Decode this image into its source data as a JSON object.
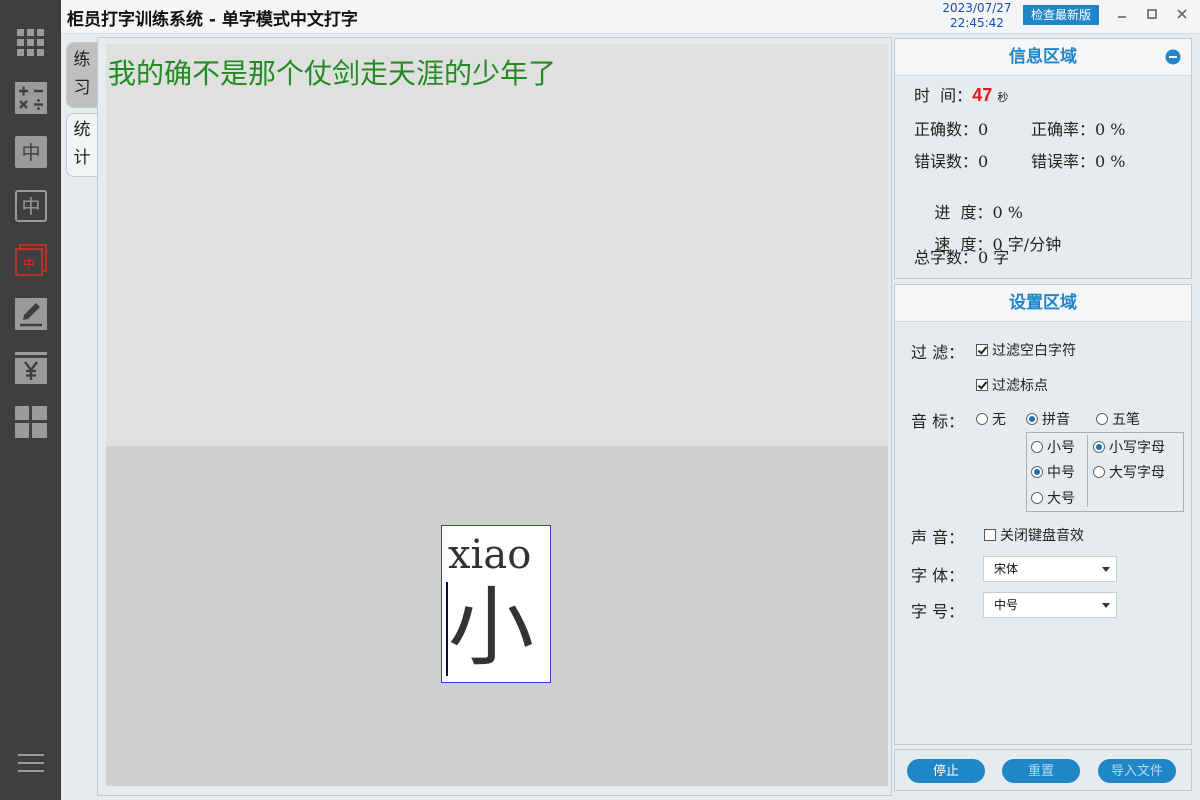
{
  "window": {
    "title": "柜员打字训练系统 - 单字模式中文打字",
    "date": "2023/07/27",
    "time": "22:45:42",
    "update_label": "检查最新版"
  },
  "rail": {
    "icons": [
      "grid-icon",
      "calculator-icon",
      "chinese-char-filled-icon",
      "chinese-char-outline-icon",
      "chinese-char-layered-icon",
      "pen-icon",
      "yen-icon",
      "tiles-icon",
      "menu-icon"
    ],
    "active_color": "#d93025",
    "icon_color": "#9a9a9a",
    "labels": {
      "zhong": "中"
    }
  },
  "tabs": {
    "practice": [
      "练",
      "习"
    ],
    "stats": [
      "统",
      "计"
    ]
  },
  "practice": {
    "text": "我的确不是那个仗剑走天涯的少年了",
    "pinyin": "xiao",
    "char": "小",
    "text_color": "#228b22"
  },
  "info": {
    "title": "信息区域",
    "time_label": "时  间：",
    "time_value": "47",
    "time_unit": "秒",
    "correct_label": "正确数：",
    "correct_value": "0",
    "accuracy_label": "正确率：",
    "accuracy_value": "0 %",
    "error_label": "错误数：",
    "error_value": "0",
    "error_rate_label": "错误率：",
    "error_rate_value": "0 %",
    "progress_label": "进  度：",
    "progress_value": "0 %",
    "speed_label": "速  度：",
    "speed_value": "0 字/分钟",
    "total_label": "总字数：",
    "total_value": "0 字"
  },
  "settings": {
    "title": "设置区域",
    "filter_label": "过 滤：",
    "filter_whitespace": "过滤空白字符",
    "filter_punct": "过滤标点",
    "phonetic_label": "音 标：",
    "phonetic_none": "无",
    "phonetic_pinyin": "拼音",
    "phonetic_wubi": "五笔",
    "size_small": "小号",
    "size_medium": "中号",
    "size_large": "大号",
    "case_lower": "小写字母",
    "case_upper": "大写字母",
    "sound_label": "声 音：",
    "sound_mute": "关闭键盘音效",
    "font_label": "字 体：",
    "font_value": "宋体",
    "fontsize_label": "字 号：",
    "fontsize_value": "中号"
  },
  "buttons": {
    "stop": "停止",
    "reset": "重置",
    "import": "导入文件"
  }
}
